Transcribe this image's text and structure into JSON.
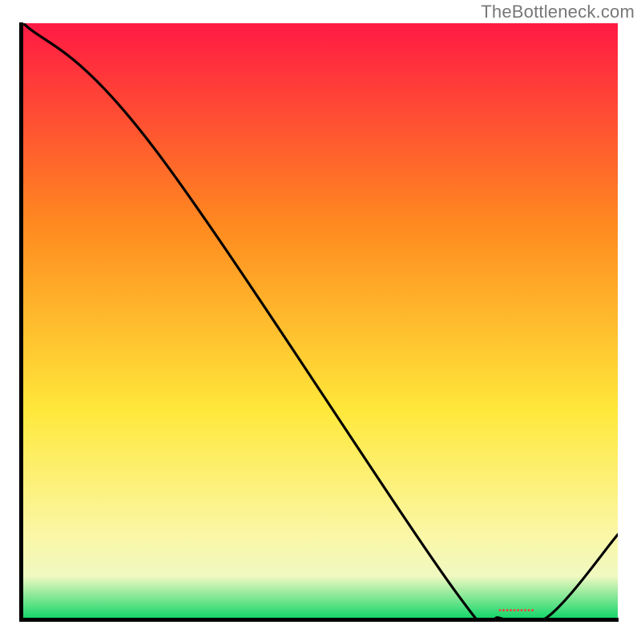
{
  "watermark": "TheBottleneck.com",
  "colors": {
    "gradient_top": "#ff1a44",
    "gradient_mid1": "#ff8a1f",
    "gradient_mid2": "#ffe83a",
    "gradient_mid3": "#fbf7a6",
    "gradient_bottom": "#17d66b",
    "axis": "#000000",
    "curve": "#000000",
    "marker": "#ff3a3a"
  },
  "chart_data": {
    "type": "line",
    "title": "",
    "xlabel": "",
    "ylabel": "",
    "xlim": [
      0,
      100
    ],
    "ylim": [
      0,
      100
    ],
    "x": [
      0,
      22,
      73,
      80,
      88,
      100
    ],
    "values": [
      100,
      79,
      4,
      0,
      0,
      14
    ],
    "annotations": [
      {
        "text": "••••••••••",
        "x": 84,
        "y": 0.5
      }
    ]
  }
}
